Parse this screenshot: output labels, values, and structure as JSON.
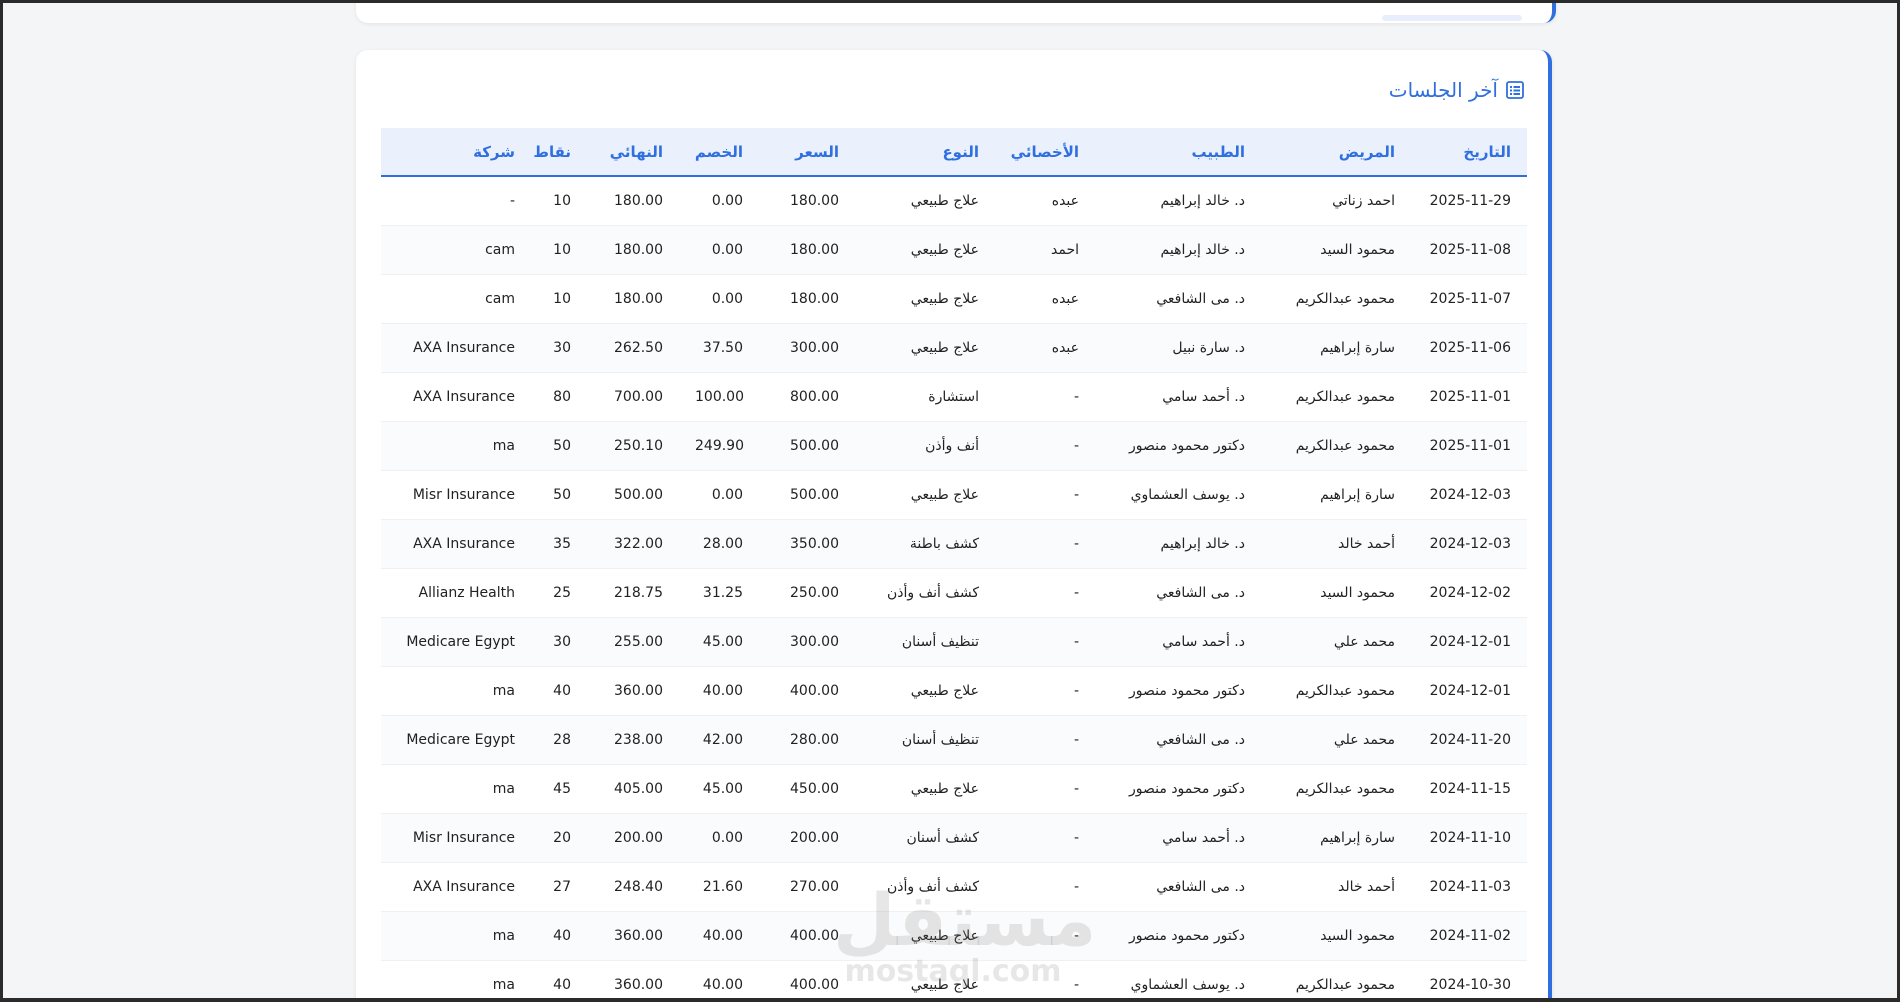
{
  "card": {
    "title": "آخر الجلسات",
    "icon": "list-icon",
    "accent": "#2f6fe0"
  },
  "table": {
    "columns": [
      "التاريخ",
      "المريض",
      "الطبيب",
      "الأخصائي",
      "النوع",
      "السعر",
      "الخصم",
      "النهائي",
      "نقاط",
      "شركة"
    ],
    "rows": [
      [
        "2025-11-29",
        "احمد زناتي",
        "د. خالد إبراهيم",
        "عبده",
        "علاج طبيعي",
        "180.00",
        "0.00",
        "180.00",
        "10",
        "-"
      ],
      [
        "2025-11-08",
        "محمود السيد",
        "د. خالد إبراهيم",
        "احمد",
        "علاج طبيعي",
        "180.00",
        "0.00",
        "180.00",
        "10",
        "cam"
      ],
      [
        "2025-11-07",
        "محمود عبدالكريم",
        "د. مى الشافعي",
        "عبده",
        "علاج طبيعي",
        "180.00",
        "0.00",
        "180.00",
        "10",
        "cam"
      ],
      [
        "2025-11-06",
        "سارة إبراهيم",
        "د. سارة نبيل",
        "عبده",
        "علاج طبيعي",
        "300.00",
        "37.50",
        "262.50",
        "30",
        "AXA Insurance"
      ],
      [
        "2025-11-01",
        "محمود عبدالكريم",
        "د. أحمد سامي",
        "-",
        "استشارة",
        "800.00",
        "100.00",
        "700.00",
        "80",
        "AXA Insurance"
      ],
      [
        "2025-11-01",
        "محمود عبدالكريم",
        "دكتور محمود منصور",
        "-",
        "أنف وأذن",
        "500.00",
        "249.90",
        "250.10",
        "50",
        "ma"
      ],
      [
        "2024-12-03",
        "سارة إبراهيم",
        "د. يوسف العشماوي",
        "-",
        "علاج طبيعي",
        "500.00",
        "0.00",
        "500.00",
        "50",
        "Misr Insurance"
      ],
      [
        "2024-12-03",
        "أحمد خالد",
        "د. خالد إبراهيم",
        "-",
        "كشف باطنة",
        "350.00",
        "28.00",
        "322.00",
        "35",
        "AXA Insurance"
      ],
      [
        "2024-12-02",
        "محمود السيد",
        "د. مى الشافعي",
        "-",
        "كشف أنف وأذن",
        "250.00",
        "31.25",
        "218.75",
        "25",
        "Allianz Health"
      ],
      [
        "2024-12-01",
        "محمد علي",
        "د. أحمد سامي",
        "-",
        "تنظيف أسنان",
        "300.00",
        "45.00",
        "255.00",
        "30",
        "Medicare Egypt"
      ],
      [
        "2024-12-01",
        "محمود عبدالكريم",
        "دكتور محمود منصور",
        "-",
        "علاج طبيعي",
        "400.00",
        "40.00",
        "360.00",
        "40",
        "ma"
      ],
      [
        "2024-11-20",
        "محمد علي",
        "د. مى الشافعي",
        "-",
        "تنظيف أسنان",
        "280.00",
        "42.00",
        "238.00",
        "28",
        "Medicare Egypt"
      ],
      [
        "2024-11-15",
        "محمود عبدالكريم",
        "دكتور محمود منصور",
        "-",
        "علاج طبيعي",
        "450.00",
        "45.00",
        "405.00",
        "45",
        "ma"
      ],
      [
        "2024-11-10",
        "سارة إبراهيم",
        "د. أحمد سامي",
        "-",
        "كشف أسنان",
        "200.00",
        "0.00",
        "200.00",
        "20",
        "Misr Insurance"
      ],
      [
        "2024-11-03",
        "أحمد خالد",
        "د. مى الشافعي",
        "-",
        "كشف أنف وأذن",
        "270.00",
        "21.60",
        "248.40",
        "27",
        "AXA Insurance"
      ],
      [
        "2024-11-02",
        "محمود السيد",
        "دكتور محمود منصور",
        "-",
        "علاج طبيعي",
        "400.00",
        "40.00",
        "360.00",
        "40",
        "ma"
      ],
      [
        "2024-10-30",
        "محمود عبدالكريم",
        "د. يوسف العشماوي",
        "-",
        "علاج طبيعي",
        "400.00",
        "40.00",
        "360.00",
        "40",
        "ma"
      ]
    ]
  },
  "watermark": {
    "arabic": "مستقل",
    "latin": "mostaql.com"
  }
}
